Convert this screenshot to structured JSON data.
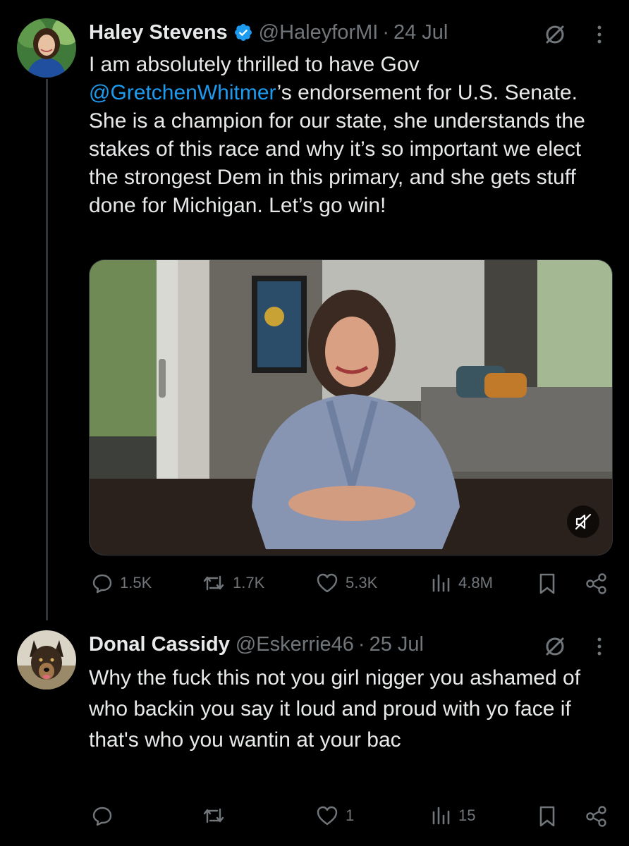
{
  "tweets": [
    {
      "name": "Haley Stevens",
      "verified": true,
      "handle": "@HaleyforMI",
      "separator": "·",
      "date": "24 Jul",
      "text_before": "I am absolutely thrilled to have Gov ",
      "mention": "@GretchenWhitmer",
      "text_after": "’s endorsement for U.S. Senate. She is a champion for our state, she understands the stakes of this race and why it’s so important we elect the strongest Dem in this primary, and she gets stuff done for Michigan. Let’s go win!",
      "has_video": true,
      "replies": "1.5K",
      "reposts": "1.7K",
      "likes": "5.3K",
      "views": "4.8M"
    },
    {
      "name": "Donal Cassidy",
      "verified": false,
      "handle": "@Eskerrie46",
      "separator": "·",
      "date": "25 Jul",
      "text": "Why the fuck this not you girl nigger you ashamed of who backin you say it loud and proud with yo face if that's who you wantin at your bac",
      "replies": "",
      "reposts": "",
      "likes": "1",
      "views": "15"
    }
  ],
  "colors": {
    "background": "#000000",
    "text": "#e7e9ea",
    "secondary": "#71767b",
    "link": "#1d9bf0",
    "verified": "#1d9bf0"
  },
  "icons": [
    "grok-icon",
    "more-icon",
    "reply-icon",
    "repost-icon",
    "like-icon",
    "views-icon",
    "bookmark-icon",
    "share-icon",
    "mute-icon",
    "verified-icon"
  ]
}
